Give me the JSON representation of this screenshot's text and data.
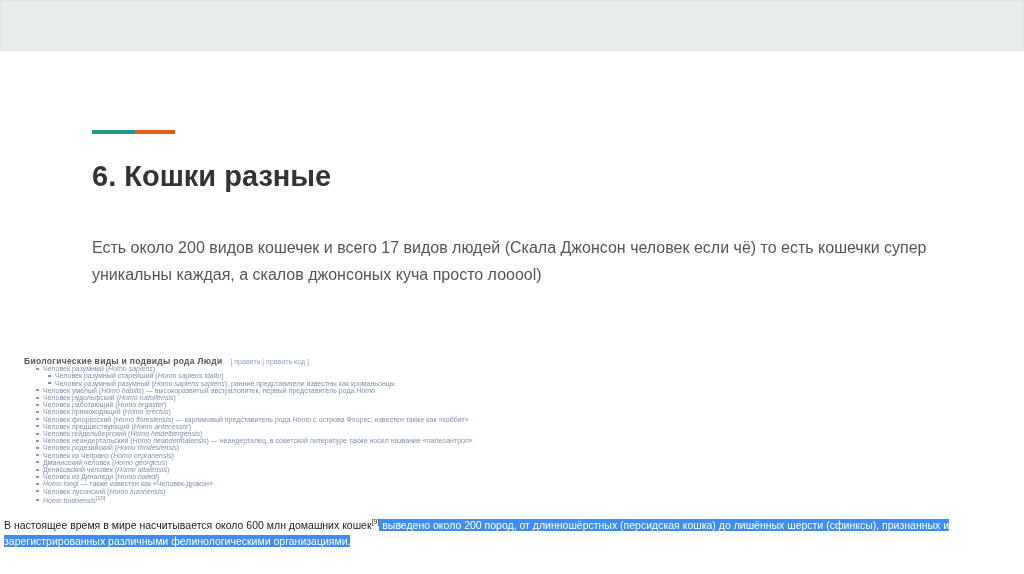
{
  "slide": {
    "title": "6. Кошки разные",
    "body": "Есть около 200 видов кошечек и всего 17 видов людей (Скала Джонсон человек если чё) то есть кошечки супер уникальны каждая, а скалов джонсоных куча просто лооool)"
  },
  "embedded": {
    "heading": "Биологические виды и подвиды рода Люди",
    "edit_links": "[ править | править код ]",
    "items": [
      {
        "text": "Человек разумный (*Homo sapiens*)",
        "children": [
          {
            "text": "Человек разумный старейший (*Homo sapiens idaltu*)"
          },
          {
            "text": "Человек разумный разумный (*Homo sapiens sapiens*), ранние представители известны как кроманьонцы"
          }
        ]
      },
      {
        "text": "Человек умелый (*Homo habilis*) — высокоразвитый австралопитек, первый представитель рода *Homo*"
      },
      {
        "text": "Человек рудольфский (*Homo rudolfensis*)"
      },
      {
        "text": "Человек работающий (*Homo ergaster*)"
      },
      {
        "text": "Человек прямоходящий (*Homo erectus*)"
      },
      {
        "text": "Человек флоресский (*Homo floresiensis*) — карликовый представитель рода *Homo* с острова Флорес, известен также как «хоббит»"
      },
      {
        "text": "Человек предшествующий (*Homo antecessor*)"
      },
      {
        "text": "Человек гейдельбергский (*Homo heidelbergensis*)"
      },
      {
        "text": "Человек неандертальский (*Homo neanderthalensis*) — неандерталец, в советской литературе также носил название «палеоантроп»"
      },
      {
        "text": "Человек родезийский (*Homo rhodesiensis*)"
      },
      {
        "text": "Человек из Чепрано (*Homo cepranensis*)"
      },
      {
        "text": "Дманисский человек (*Homo georgicus*)"
      },
      {
        "text": "Денисовский человек (*Homo altaiensis*)"
      },
      {
        "text": "Человек из Диналеди (*Homo naledi*)"
      },
      {
        "text": "*Homo longi* — также известен как «Человек-дракон»"
      },
      {
        "text": "Человек лусонский (*Homo luzonensis*)"
      },
      {
        "text": "*Homo bodoensis*$^{[10]}$"
      }
    ]
  },
  "paragraph": {
    "text": "В настоящее время в мире насчитывается около 600 млн домашних кошек$^{[9]}$",
    "selected_text": "выведено около 200 пород, от длинношёрстных (персидская кошка) до лишённых шерсти (сфинксы), признанных и зарегистрированных различными фелинологическими организациями."
  }
}
